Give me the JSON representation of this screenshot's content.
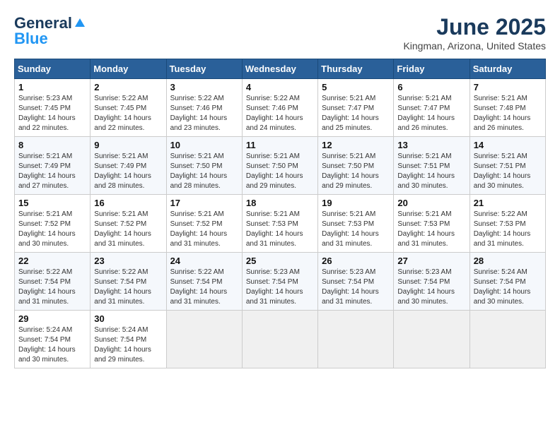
{
  "logo": {
    "general": "General",
    "blue": "Blue"
  },
  "title": "June 2025",
  "location": "Kingman, Arizona, United States",
  "days_of_week": [
    "Sunday",
    "Monday",
    "Tuesday",
    "Wednesday",
    "Thursday",
    "Friday",
    "Saturday"
  ],
  "weeks": [
    [
      {
        "day": "1",
        "sunrise": "5:23 AM",
        "sunset": "7:45 PM",
        "daylight": "14 hours and 22 minutes."
      },
      {
        "day": "2",
        "sunrise": "5:22 AM",
        "sunset": "7:45 PM",
        "daylight": "14 hours and 22 minutes."
      },
      {
        "day": "3",
        "sunrise": "5:22 AM",
        "sunset": "7:46 PM",
        "daylight": "14 hours and 23 minutes."
      },
      {
        "day": "4",
        "sunrise": "5:22 AM",
        "sunset": "7:46 PM",
        "daylight": "14 hours and 24 minutes."
      },
      {
        "day": "5",
        "sunrise": "5:21 AM",
        "sunset": "7:47 PM",
        "daylight": "14 hours and 25 minutes."
      },
      {
        "day": "6",
        "sunrise": "5:21 AM",
        "sunset": "7:47 PM",
        "daylight": "14 hours and 26 minutes."
      },
      {
        "day": "7",
        "sunrise": "5:21 AM",
        "sunset": "7:48 PM",
        "daylight": "14 hours and 26 minutes."
      }
    ],
    [
      {
        "day": "8",
        "sunrise": "5:21 AM",
        "sunset": "7:49 PM",
        "daylight": "14 hours and 27 minutes."
      },
      {
        "day": "9",
        "sunrise": "5:21 AM",
        "sunset": "7:49 PM",
        "daylight": "14 hours and 28 minutes."
      },
      {
        "day": "10",
        "sunrise": "5:21 AM",
        "sunset": "7:50 PM",
        "daylight": "14 hours and 28 minutes."
      },
      {
        "day": "11",
        "sunrise": "5:21 AM",
        "sunset": "7:50 PM",
        "daylight": "14 hours and 29 minutes."
      },
      {
        "day": "12",
        "sunrise": "5:21 AM",
        "sunset": "7:50 PM",
        "daylight": "14 hours and 29 minutes."
      },
      {
        "day": "13",
        "sunrise": "5:21 AM",
        "sunset": "7:51 PM",
        "daylight": "14 hours and 30 minutes."
      },
      {
        "day": "14",
        "sunrise": "5:21 AM",
        "sunset": "7:51 PM",
        "daylight": "14 hours and 30 minutes."
      }
    ],
    [
      {
        "day": "15",
        "sunrise": "5:21 AM",
        "sunset": "7:52 PM",
        "daylight": "14 hours and 30 minutes."
      },
      {
        "day": "16",
        "sunrise": "5:21 AM",
        "sunset": "7:52 PM",
        "daylight": "14 hours and 31 minutes."
      },
      {
        "day": "17",
        "sunrise": "5:21 AM",
        "sunset": "7:52 PM",
        "daylight": "14 hours and 31 minutes."
      },
      {
        "day": "18",
        "sunrise": "5:21 AM",
        "sunset": "7:53 PM",
        "daylight": "14 hours and 31 minutes."
      },
      {
        "day": "19",
        "sunrise": "5:21 AM",
        "sunset": "7:53 PM",
        "daylight": "14 hours and 31 minutes."
      },
      {
        "day": "20",
        "sunrise": "5:21 AM",
        "sunset": "7:53 PM",
        "daylight": "14 hours and 31 minutes."
      },
      {
        "day": "21",
        "sunrise": "5:22 AM",
        "sunset": "7:53 PM",
        "daylight": "14 hours and 31 minutes."
      }
    ],
    [
      {
        "day": "22",
        "sunrise": "5:22 AM",
        "sunset": "7:54 PM",
        "daylight": "14 hours and 31 minutes."
      },
      {
        "day": "23",
        "sunrise": "5:22 AM",
        "sunset": "7:54 PM",
        "daylight": "14 hours and 31 minutes."
      },
      {
        "day": "24",
        "sunrise": "5:22 AM",
        "sunset": "7:54 PM",
        "daylight": "14 hours and 31 minutes."
      },
      {
        "day": "25",
        "sunrise": "5:23 AM",
        "sunset": "7:54 PM",
        "daylight": "14 hours and 31 minutes."
      },
      {
        "day": "26",
        "sunrise": "5:23 AM",
        "sunset": "7:54 PM",
        "daylight": "14 hours and 31 minutes."
      },
      {
        "day": "27",
        "sunrise": "5:23 AM",
        "sunset": "7:54 PM",
        "daylight": "14 hours and 30 minutes."
      },
      {
        "day": "28",
        "sunrise": "5:24 AM",
        "sunset": "7:54 PM",
        "daylight": "14 hours and 30 minutes."
      }
    ],
    [
      {
        "day": "29",
        "sunrise": "5:24 AM",
        "sunset": "7:54 PM",
        "daylight": "14 hours and 30 minutes."
      },
      {
        "day": "30",
        "sunrise": "5:24 AM",
        "sunset": "7:54 PM",
        "daylight": "14 hours and 29 minutes."
      },
      null,
      null,
      null,
      null,
      null
    ]
  ]
}
